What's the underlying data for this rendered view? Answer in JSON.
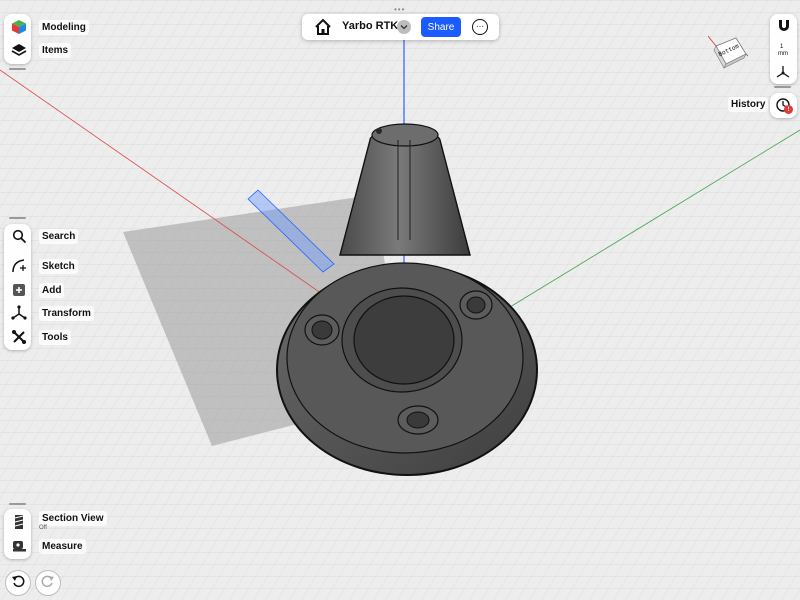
{
  "app": {
    "project_title": "Yarbo RTK",
    "share_label": "Share"
  },
  "left_top": [
    {
      "label": "Modeling",
      "icon": "modeling-cube-icon"
    },
    {
      "label": "Items",
      "icon": "layers-icon"
    }
  ],
  "left_tools": [
    {
      "label": "Search",
      "icon": "search-icon"
    },
    {
      "label": "Sketch",
      "icon": "sketch-icon"
    },
    {
      "label": "Add",
      "icon": "add-icon"
    },
    {
      "label": "Transform",
      "icon": "transform-icon"
    },
    {
      "label": "Tools",
      "icon": "tools-icon"
    }
  ],
  "left_bottom": {
    "section_view_label": "Section View",
    "section_view_state": "Off",
    "measure_label": "Measure"
  },
  "right": {
    "view_cube_face": "Bottom",
    "unit_value": "1",
    "unit_label": "mm",
    "history_label": "History",
    "history_badge": "!"
  },
  "colors": {
    "accent": "#1a5cff",
    "axis_x": "#d94a4a",
    "axis_y": "#3fa34d",
    "axis_z": "#2b62ff",
    "badge": "#e53935"
  }
}
